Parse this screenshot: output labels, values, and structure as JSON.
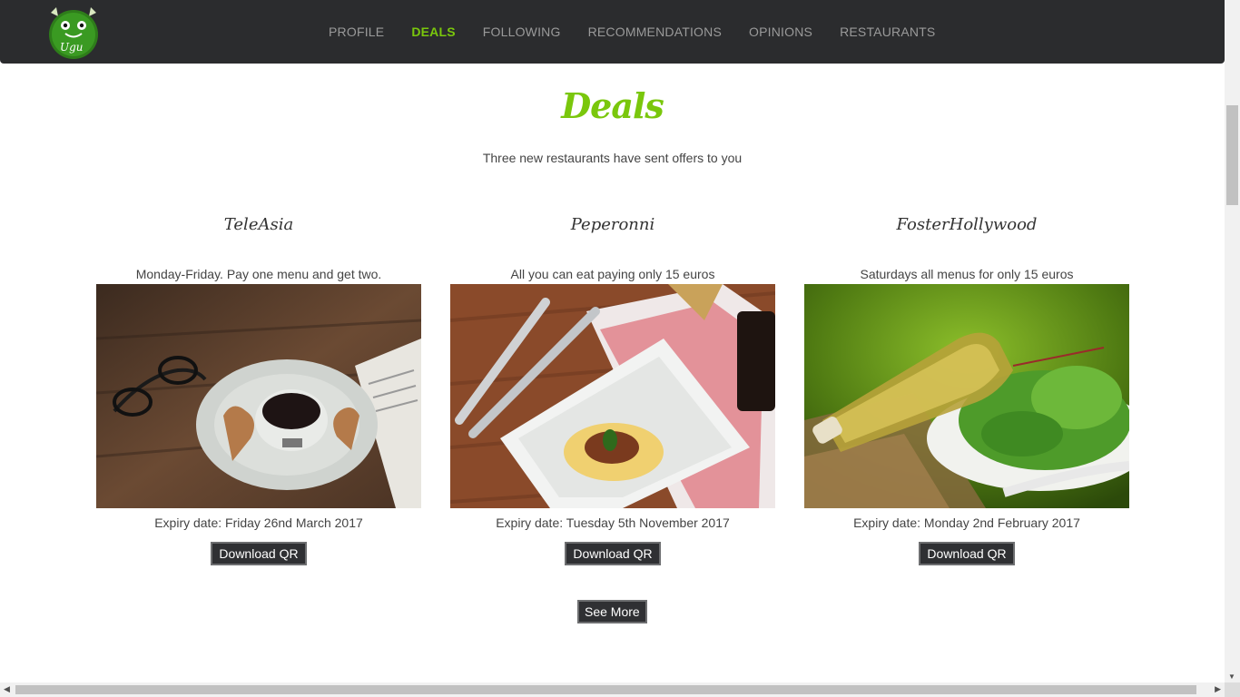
{
  "nav": {
    "items": [
      {
        "label": "PROFILE",
        "active": false
      },
      {
        "label": "DEALS",
        "active": true
      },
      {
        "label": "FOLLOWING",
        "active": false
      },
      {
        "label": "RECOMMENDATIONS",
        "active": false
      },
      {
        "label": "OPINIONS",
        "active": false
      },
      {
        "label": "RESTAURANTS",
        "active": false
      }
    ],
    "accent_color": "#7ac70c",
    "background_color": "#2b2c2e"
  },
  "logo": {
    "icon": "green-monster-logo-icon"
  },
  "page": {
    "title": "Deals",
    "subtitle": "Three new restaurants have sent offers to you"
  },
  "deals": [
    {
      "restaurant": "TeleAsia",
      "offer": "Monday-Friday. Pay one menu and get two.",
      "image": "coffee-cup-photo",
      "expiry": "Expiry date: Friday 26nd March 2017",
      "button": "Download QR"
    },
    {
      "restaurant": "Peperonni",
      "offer": "All you can eat paying only 15 euros",
      "image": "pasta-plate-photo",
      "expiry": "Expiry date: Tuesday 5th November 2017",
      "button": "Download QR"
    },
    {
      "restaurant": "FosterHollywood",
      "offer": "Saturdays all menus for only 15 euros",
      "image": "salad-olive-oil-photo",
      "expiry": "Expiry date: Monday 2nd February 2017",
      "button": "Download QR"
    }
  ],
  "see_more_label": "See More"
}
